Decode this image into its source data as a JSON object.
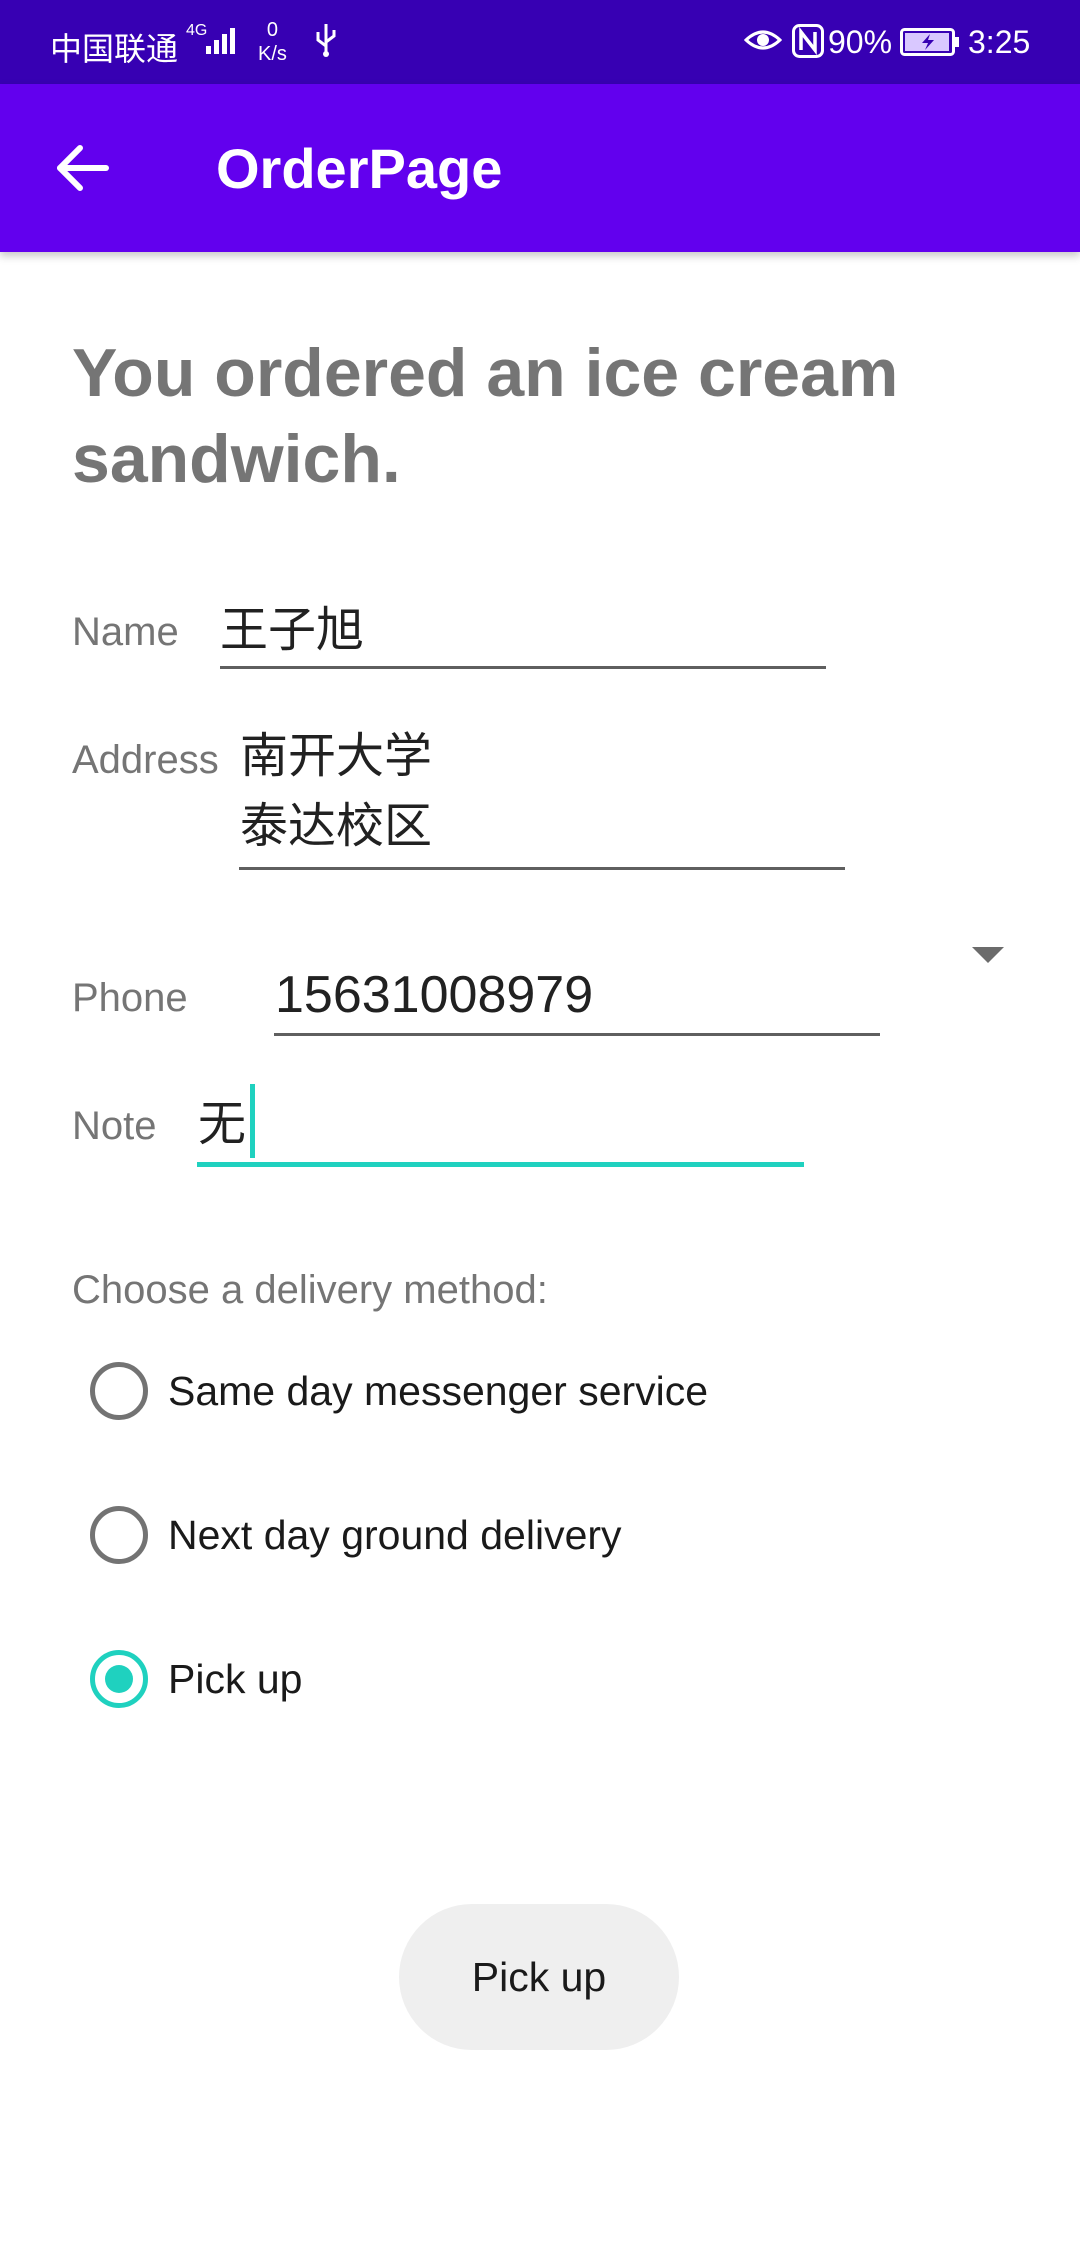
{
  "status_bar": {
    "carrier": "中国联通",
    "network_tag": "4G",
    "speed_value": "0",
    "speed_unit": "K/s",
    "battery_percent": "90%",
    "time": "3:25",
    "icons": [
      "signal-icon",
      "usb-icon",
      "eye-icon",
      "nfc-icon",
      "battery-charging-icon"
    ]
  },
  "app_bar": {
    "title": "OrderPage",
    "back_icon": "arrow-left-icon"
  },
  "main": {
    "headline": "You ordered an ice cream sandwich.",
    "name": {
      "label": "Name",
      "value": "王子旭"
    },
    "address": {
      "label": "Address",
      "value": "南开大学\n泰达校区"
    },
    "phone": {
      "label": "Phone",
      "value": "15631008979",
      "spinner_icon": "dropdown-arrow-icon"
    },
    "note": {
      "label": "Note",
      "value": "无"
    },
    "delivery": {
      "label": "Choose a delivery method:",
      "options": [
        {
          "label": "Same day messenger service",
          "checked": false
        },
        {
          "label": "Next day ground delivery",
          "checked": false
        },
        {
          "label": "Pick up",
          "checked": true
        }
      ]
    },
    "button_label": "Pick up"
  },
  "colors": {
    "status_bar": "#3700b3",
    "app_bar": "#6200ee",
    "accent": "#1fd1bf",
    "secondary_text": "#757575"
  }
}
